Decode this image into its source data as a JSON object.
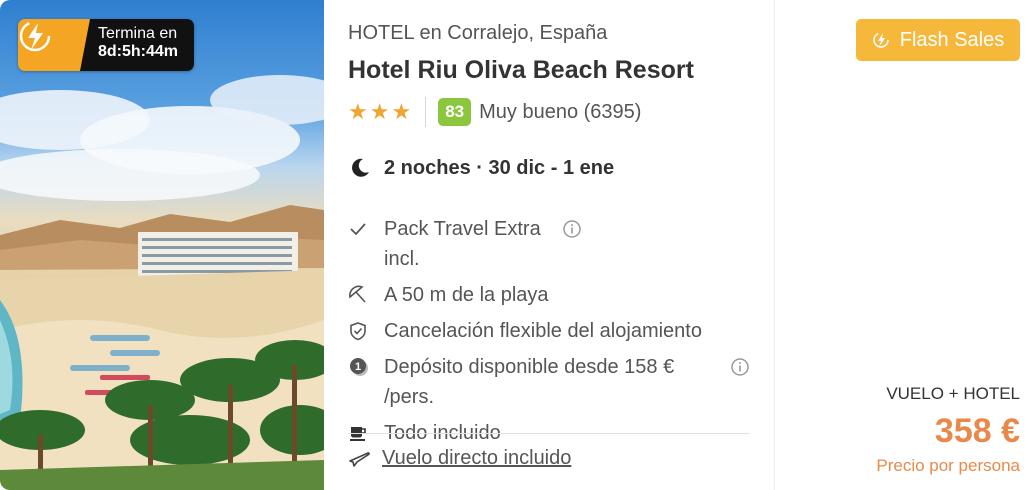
{
  "countdown": {
    "label": "Termina en",
    "time": "8d:5h:44m",
    "icon": "lightning-icon"
  },
  "hotel": {
    "location": "HOTEL en Corralejo, España",
    "name": "Hotel Riu Oliva Beach Resort",
    "stars": 3,
    "score": "83",
    "score_text": "Muy bueno (6395)"
  },
  "stay": {
    "text": "2 noches · 30 dic - 1 ene",
    "icon": "moon-icon"
  },
  "features": [
    {
      "icon": "check-icon",
      "text": "Pack Travel Extra incl.",
      "info": true
    },
    {
      "icon": "beach-umbrella-icon",
      "text": "A 50 m de la playa",
      "info": false
    },
    {
      "icon": "shield-check-icon",
      "text": "Cancelación flexible del alojamiento",
      "info": false
    },
    {
      "icon": "deposit-icon",
      "text": "Depósito disponible desde 158 € /pers.",
      "info": true
    },
    {
      "icon": "coffee-cup-icon",
      "text": "Todo incluido",
      "info": false
    }
  ],
  "flight": {
    "icon": "plane-icon",
    "text": "Vuelo directo incluido"
  },
  "price": {
    "badge": "Flash Sales",
    "pack_label": "VUELO + HOTEL",
    "amount": "358 €",
    "note": "Precio por persona"
  },
  "colors": {
    "accent": "#f5a524",
    "badge": "#f5b83a",
    "price": "#e8894a",
    "score": "#8cc63f",
    "star": "#f0a532"
  }
}
